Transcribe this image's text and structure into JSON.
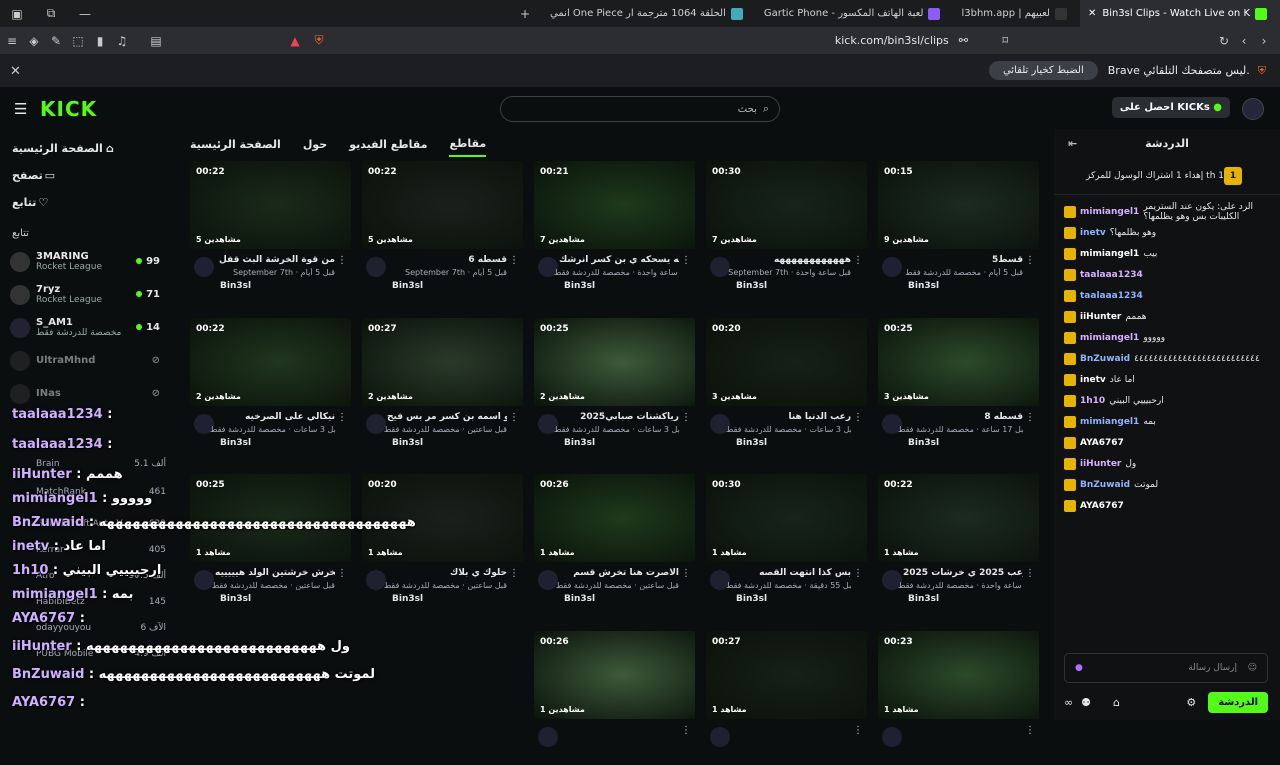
{
  "browser": {
    "tabs": [
      {
        "label": "Bin3sl Clips - Watch Live on K"
      },
      {
        "label": "l3bhm.app | لعبيهم"
      },
      {
        "label": "Gartic Phone - لعبة الهاتف المكسور"
      },
      {
        "label": "انمي One Piece الحلقة 1064 مترجمة ار"
      }
    ],
    "url": "kick.com/bin3sl/clips",
    "infobar_text": "Brave ليس متصفحك التلقائي.",
    "infobar_button": "الضبط كخيار تلقائي"
  },
  "header": {
    "logo": "KICK",
    "search_placeholder": "بحث",
    "get_kicks": "احصل على KICKs"
  },
  "sidebar": {
    "links": [
      {
        "label": "الصفحة الرئيسية",
        "icon": "home-icon"
      },
      {
        "label": "تصفح",
        "icon": "browse-icon"
      },
      {
        "label": "تتابع",
        "icon": "heart-icon"
      }
    ],
    "following_header": "تتابع",
    "channels": [
      {
        "name": "3MARING",
        "sub": "Rocket League",
        "viewers": "99"
      },
      {
        "name": "7ryz",
        "sub": "Rocket League",
        "viewers": "71"
      },
      {
        "name": "S_AM1",
        "sub": "مخصصة للدردشة فقط",
        "viewers": "14"
      },
      {
        "name": "UltraMhnd",
        "sub": "",
        "viewers": ""
      },
      {
        "name": "INas",
        "sub": "",
        "viewers": ""
      },
      {
        "name": "Brain",
        "sub": "",
        "viewers": "5.1 ألف"
      },
      {
        "name": "MatchRank",
        "sub": "",
        "viewers": "461"
      },
      {
        "name": "Grand Theft Auto V",
        "sub": "",
        "viewers": "639"
      },
      {
        "name": "Karrar",
        "sub": "",
        "viewers": "405"
      },
      {
        "name": "Atro",
        "sub": "",
        "viewers": "30.5 ألف"
      },
      {
        "name": "HabibiBetz",
        "sub": "",
        "viewers": "145"
      },
      {
        "name": "odayyouyou",
        "sub": "",
        "viewers": "6 الآف"
      },
      {
        "name": "PUBG Mobile",
        "sub": "",
        "viewers": "4.9 ألف"
      }
    ]
  },
  "content_tabs": [
    "الصفحة الرئيسية",
    "حول",
    "مقاطع الفيديو",
    "مقاطع"
  ],
  "clips": [
    {
      "duration": "00:15",
      "views": "9 مشاهدين",
      "title": "قسط5",
      "sub": "قبل 5 أيام · مخصصة للدردشة فقط",
      "channel": "Bin3sl"
    },
    {
      "duration": "00:30",
      "views": "7 مشاهدين",
      "title": "ههههههههههههه",
      "sub": "September 7th · قبل ساعة واحدة",
      "channel": "Bin3sl"
    },
    {
      "duration": "00:21",
      "views": "7 مشاهدين",
      "title": "الله يسحكه ي بن كسر انرشك ...",
      "sub": "قبل ساعة واحدة · مخصصة للدردشة فقط",
      "channel": "Bin3sl"
    },
    {
      "duration": "00:22",
      "views": "5 مشاهدين",
      "title": "قسطه 6",
      "sub": "September 7th · قبل 5 أيام",
      "channel": "Bin3sl"
    },
    {
      "duration": "00:22",
      "views": "5 مشاهدين",
      "title": "من قوة الخرشة البث قفل",
      "sub": "September 7th · قبل 5 أيام",
      "channel": "Bin3sl"
    },
    {
      "duration": "00:25",
      "views": "3 مشاهدين",
      "title": "قسطه 8",
      "sub": "قبل 17 ساعة · مخصصة للدردشة فقط",
      "channel": "Bin3sl"
    },
    {
      "duration": "00:20",
      "views": "3 مشاهدين",
      "title": "رعب الدنيا هنا",
      "sub": "قبل 3 ساعات · مخصصة للدردشة فقط",
      "channel": "Bin3sl"
    },
    {
      "duration": "00:25",
      "views": "2 مشاهدين",
      "title": "رياكشنات صبابي2025",
      "sub": "قبل 3 ساعات · مخصصة للدردشة فقط",
      "channel": "Bin3sl"
    },
    {
      "duration": "00:27",
      "views": "2 مشاهدين",
      "title": "ساو اسمه بن كسر مر بس فيح...",
      "sub": "قبل ساعتين · مخصصة للدردشة فقط",
      "channel": "Bin3sl"
    },
    {
      "duration": "00:22",
      "views": "2 مشاهدين",
      "title": "نيكالي على الصرخيه",
      "sub": "قبل 3 ساعات · مخصصة للدردشة فقط",
      "channel": "Bin3sl"
    },
    {
      "duration": "00:22",
      "views": "1 مشاهد",
      "title": "رعب 2025 ي خرشات 2025",
      "sub": "قبل ساعة واحدة · مخصصة للدردشة فقط",
      "channel": "Bin3sl"
    },
    {
      "duration": "00:30",
      "views": "1 مشاهد",
      "title": "بس كذا انتهت القصه",
      "sub": "قبل 55 دقيقة · مخصصة للدردشة فقط",
      "channel": "Bin3sl"
    },
    {
      "duration": "00:26",
      "views": "1 مشاهد",
      "title": "الاصرت هنا تخرش قسم",
      "sub": "قبل ساعتين · مخصصة للدردشة فقط",
      "channel": "Bin3sl"
    },
    {
      "duration": "00:20",
      "views": "1 مشاهد",
      "title": "حلوك ي بلاك",
      "sub": "قبل ساعتين · مخصصة للدردشة فقط",
      "channel": "Bin3sl"
    },
    {
      "duration": "00:25",
      "views": "1 مشاهد",
      "title": "انخرش خرشتين الولد هيييييه...",
      "sub": "قبل ساعتين · مخصصة للدردشة فقط",
      "channel": "Bin3sl"
    },
    {
      "duration": "00:23",
      "views": "1 مشاهد",
      "title": "",
      "sub": "",
      "channel": ""
    },
    {
      "duration": "00:27",
      "views": "1 مشاهد",
      "title": "",
      "sub": "",
      "channel": ""
    },
    {
      "duration": "00:26",
      "views": "1 مشاهدين",
      "title": "",
      "sub": "",
      "channel": ""
    }
  ],
  "chat": {
    "title": "الدردشة",
    "pinned": "إهداء 1 اشتراك الوسول للمركز th 1",
    "messages": [
      {
        "user": "mimiangel1",
        "text": "الرد على: يكون عند الستريمر الكليبات بس وهو يظلمها؟"
      },
      {
        "user": "inetv",
        "text": "وهو بظلمها؟"
      },
      {
        "user": "mimiangel1",
        "text": "بيب"
      },
      {
        "user": "taalaaa1234",
        "text": ""
      },
      {
        "user": "taalaaa1234",
        "text": ""
      },
      {
        "user": "iiHunter",
        "text": "هممم"
      },
      {
        "user": "mimiangel1",
        "text": "ووووو"
      },
      {
        "user": "BnZuwaid",
        "text": "٤٤٤٤٤٤٤٤٤٤٤٤٤٤٤٤٤٤٤٤٤٤٤٤٤٤"
      },
      {
        "user": "inetv",
        "text": "اما عاد"
      },
      {
        "user": "1h10",
        "text": "ارحبيييي البيني"
      },
      {
        "user": "mimiangel1",
        "text": "بمه"
      },
      {
        "user": "AYA6767",
        "text": ""
      },
      {
        "user": "iiHunter",
        "text": "ول"
      },
      {
        "user": "BnZuwaid",
        "text": "لموتت"
      },
      {
        "user": "AYA6767",
        "text": ""
      }
    ],
    "input_placeholder": "إرسال رسالة",
    "send_button": "الدردشة"
  },
  "overlay_chat": [
    {
      "user": "taalaaa1234",
      "text": ""
    },
    {
      "user": "taalaaa1234",
      "text": ""
    },
    {
      "user": "iiHunter",
      "text": "هممم"
    },
    {
      "user": "mimiangel1",
      "text": "ووووو"
    },
    {
      "user": "BnZuwaid",
      "text": "ههههههههههههههههههههههههههههههههههههه"
    },
    {
      "user": "inetv",
      "text": "اما عاد"
    },
    {
      "user": "1h10",
      "text": "ارحبيييي البيني"
    },
    {
      "user": "mimiangel1",
      "text": "بمه"
    },
    {
      "user": "AYA6767",
      "text": ""
    },
    {
      "user": "iiHunter",
      "text": "ول هههههههههههههههههههههههههههه"
    },
    {
      "user": "BnZuwaid",
      "text": "لموتت ههههههههههههههههههههههههههه"
    },
    {
      "user": "AYA6767",
      "text": ""
    }
  ],
  "colors": {
    "accent": "#53fc18",
    "bg": "#0b0e0f"
  }
}
